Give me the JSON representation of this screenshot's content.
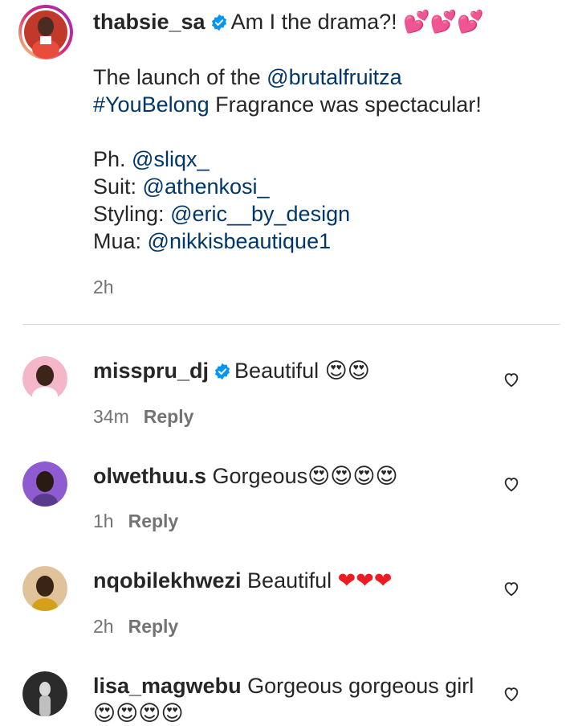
{
  "post": {
    "username": "thabsie_sa",
    "title": "Am I the drama?!",
    "title_emoji": "💕💕💕",
    "line1_prefix": "The launch of the",
    "line1_mention": "@brutalfruitza",
    "line2_hashtag": "#YouBelong",
    "line2_suffix": "Fragrance was spectacular!",
    "credits": [
      {
        "label": "Ph.",
        "handle": "@sliqx_"
      },
      {
        "label": "Suit:",
        "handle": "@athenkosi_"
      },
      {
        "label": "Styling:",
        "handle": "@eric__by_design"
      },
      {
        "label": "Mua:",
        "handle": "@nikkisbeautique1"
      }
    ],
    "time": "2h"
  },
  "comments": [
    {
      "username": "misspru_dj",
      "verified": true,
      "text": "Beautiful",
      "emoji": "😍😍",
      "time": "34m",
      "reply": "Reply"
    },
    {
      "username": "olwethuu.s",
      "verified": false,
      "text": "Gorgeous",
      "emoji": "😍😍😍😍",
      "time": "1h",
      "reply": "Reply"
    },
    {
      "username": "nqobilekhwezi",
      "verified": false,
      "text": "Beautiful",
      "emoji": "❤❤❤",
      "time": "2h",
      "reply": "Reply"
    },
    {
      "username": "lisa_magwebu",
      "verified": false,
      "text": "Gorgeous gorgeous girl",
      "emoji": "😍😍😍😍",
      "time": "",
      "reply": ""
    }
  ],
  "icons": {
    "verified": "verified-badge-icon",
    "like": "heart-outline-icon"
  },
  "colors": {
    "link": "#00376b",
    "verified": "#0095f6",
    "muted": "#737373",
    "avatar_ring": "#d6249f"
  }
}
